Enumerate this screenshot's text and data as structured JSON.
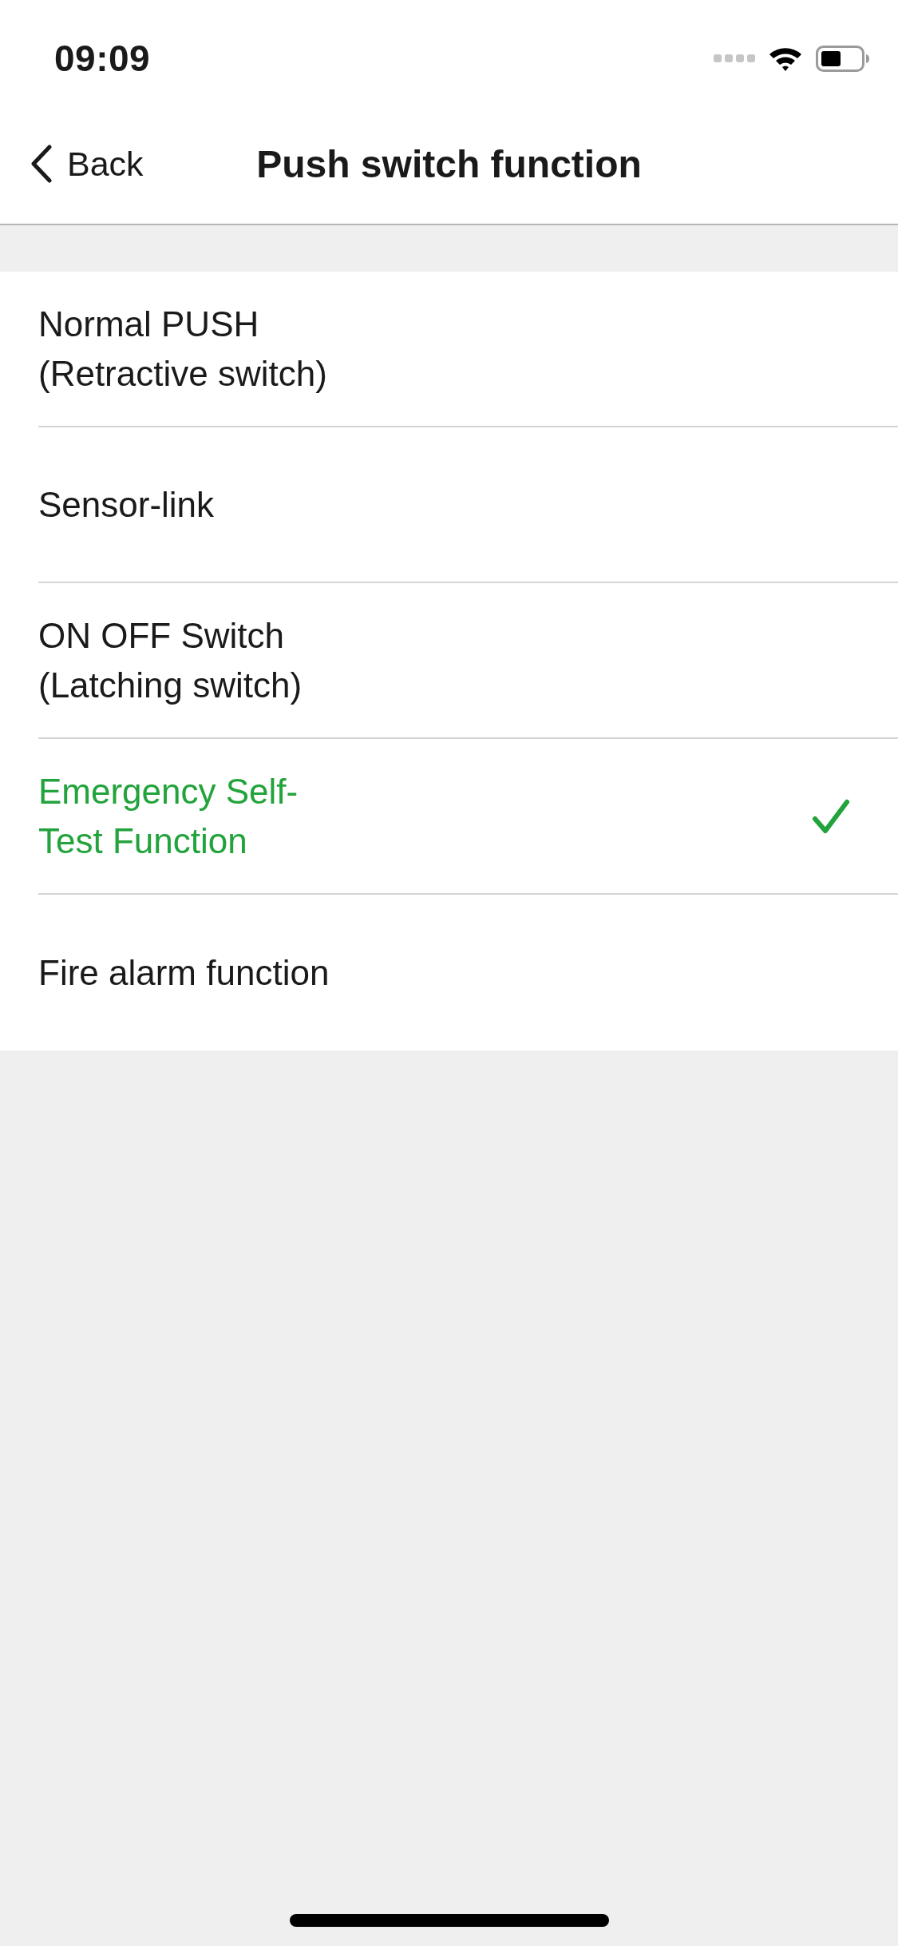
{
  "status_bar": {
    "time": "09:09"
  },
  "nav_bar": {
    "back_label": "Back",
    "title": "Push switch function"
  },
  "options": [
    {
      "label": "Normal PUSH (Retractive switch)",
      "selected": false
    },
    {
      "label": "Sensor-link",
      "selected": false
    },
    {
      "label": "ON OFF Switch (Latching switch)",
      "selected": false
    },
    {
      "label": "Emergency Self-Test Function",
      "selected": true
    },
    {
      "label": "Fire alarm function",
      "selected": false
    }
  ]
}
